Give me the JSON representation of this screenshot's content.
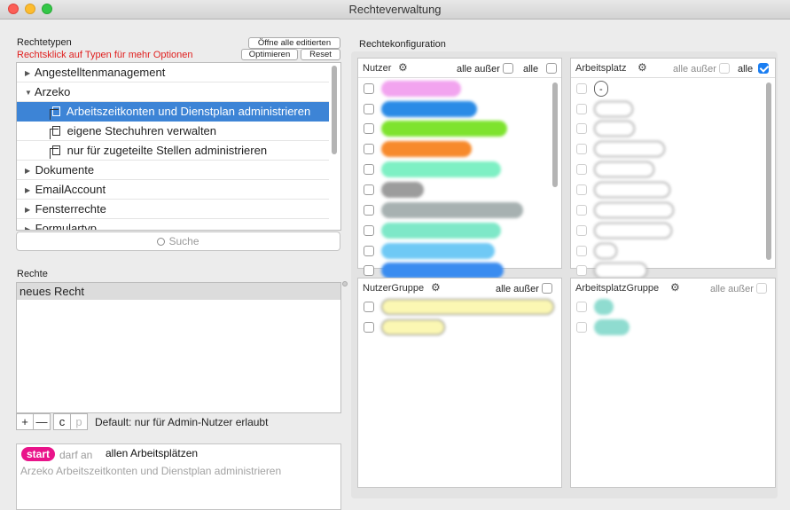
{
  "window": {
    "title": "Rechteverwaltung"
  },
  "left": {
    "types_label": "Rechtetypen",
    "hint": "Rechtsklick auf Typen für mehr Optionen",
    "btn_open_all": "Öffne alle editierten",
    "btn_optimize": "Optimieren",
    "btn_reset": "Reset",
    "tree": [
      {
        "label": "Angestelltenmanagement"
      },
      {
        "label": "Arzeko"
      },
      {
        "label": "Arbeitszeitkonten und Dienstplan administrieren"
      },
      {
        "label": "eigene Stechuhren verwalten"
      },
      {
        "label": "nur für zugeteilte Stellen administrieren"
      },
      {
        "label": "Dokumente"
      },
      {
        "label": "EmailAccount"
      },
      {
        "label": "Fensterrechte"
      },
      {
        "label": "Formulartyp"
      }
    ],
    "search_placeholder": "Suche",
    "rights_label": "Rechte",
    "rights": [
      "neues Recht"
    ],
    "btn_add": "+",
    "btn_remove": "—",
    "btn_c": "c",
    "btn_p": "p",
    "default_text": "Default: nur für Admin-Nutzer erlaubt",
    "info": {
      "badge": "start",
      "verb": "darf an",
      "target": "allen Arbeitsplätzen",
      "description": "Arzeko Arbeitszeitkonten und Dienstplan administrieren"
    }
  },
  "right": {
    "config_label": "Rechtekonfiguration",
    "nutzer": {
      "title": "Nutzer",
      "all_except": "alle außer",
      "all": "alle"
    },
    "arbeitsplatz": {
      "title": "Arbeitsplatz",
      "all_except": "alle außer",
      "all": "alle",
      "first_item": "-"
    },
    "nutzergruppe": {
      "title": "NutzerGruppe",
      "all_except": "alle außer"
    },
    "arbeitsplatzgruppe": {
      "title": "ArbeitsplatzGruppe",
      "all_except": "alle außer"
    }
  },
  "colors": {
    "selection": "#3d84d6",
    "hint_red": "#e0201f",
    "badge": "#e9148a",
    "checkbox_on": "#1a7ef2"
  }
}
